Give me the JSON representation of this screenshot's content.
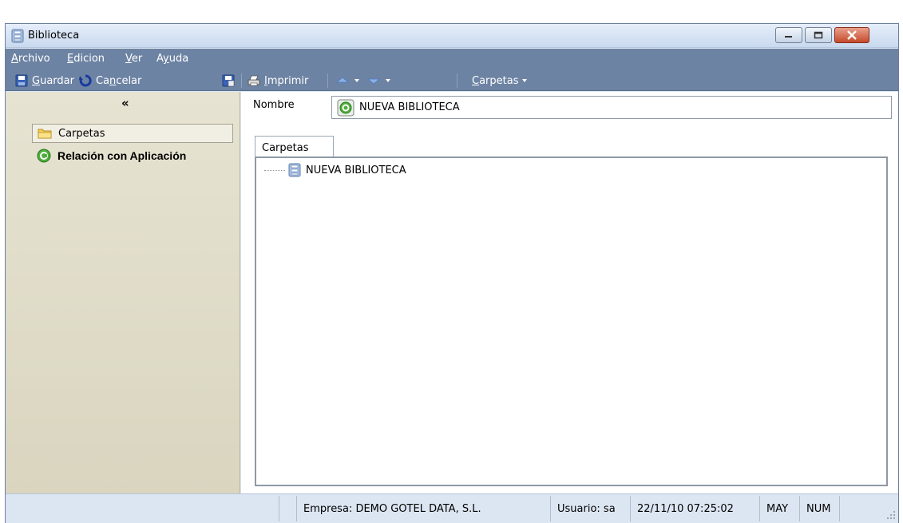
{
  "window": {
    "title": "Biblioteca",
    "icon": "library-icon",
    "controls": [
      "minimize-icon",
      "maximize-icon",
      "close-icon"
    ]
  },
  "menu": {
    "items": [
      {
        "label": "Archivo",
        "hotkey": "A",
        "rest": "rchivo"
      },
      {
        "label": "Edicion",
        "hotkey": "E",
        "rest": "dicion"
      },
      {
        "label": "Ver",
        "hotkey": "V",
        "rest": "er"
      },
      {
        "label": "Ayuda",
        "pre": "A",
        "hotkey": "y",
        "rest": "uda"
      }
    ]
  },
  "toolbar": {
    "guardar": {
      "hotkey": "G",
      "rest": "uardar",
      "icon": "save-icon"
    },
    "cancelar": {
      "pre": "Ca",
      "hotkey": "n",
      "rest": "celar",
      "icon": "undo-icon"
    },
    "save_close_icon": "save-close-icon",
    "imprimir": {
      "hotkey": "I",
      "rest": "mprimir",
      "icon": "printer-icon"
    },
    "nav_up_icon": "arrow-up-icon",
    "nav_down_icon": "arrow-down-icon",
    "carpetas": {
      "hotkey": "C",
      "rest": "arpetas"
    }
  },
  "sidebar": {
    "collapse_label": "«",
    "items": [
      {
        "label": "Carpetas",
        "icon": "folder-icon",
        "selected": true
      },
      {
        "label": "Relación con Aplicación",
        "icon": "app-relation-icon",
        "selected": false
      }
    ]
  },
  "form": {
    "nombre_label": "Nombre",
    "nombre_value": "NUEVA BIBLIOTECA"
  },
  "tabs": [
    {
      "label": "Carpetas",
      "active": true
    }
  ],
  "tree": {
    "nodes": [
      {
        "label": "NUEVA BIBLIOTECA",
        "icon": "library-icon"
      }
    ]
  },
  "statusbar": {
    "empresa": "Empresa: DEMO GOTEL DATA, S.L.",
    "usuario": "Usuario: sa",
    "datetime": "22/11/10 07:25:02",
    "may": "MAY",
    "num": "NUM"
  },
  "colors": {
    "menu_bar": "#6d83a3",
    "title_bar": "#d4e0f0",
    "sidebar": "#dedbc8",
    "close_button": "#c44a2b"
  }
}
